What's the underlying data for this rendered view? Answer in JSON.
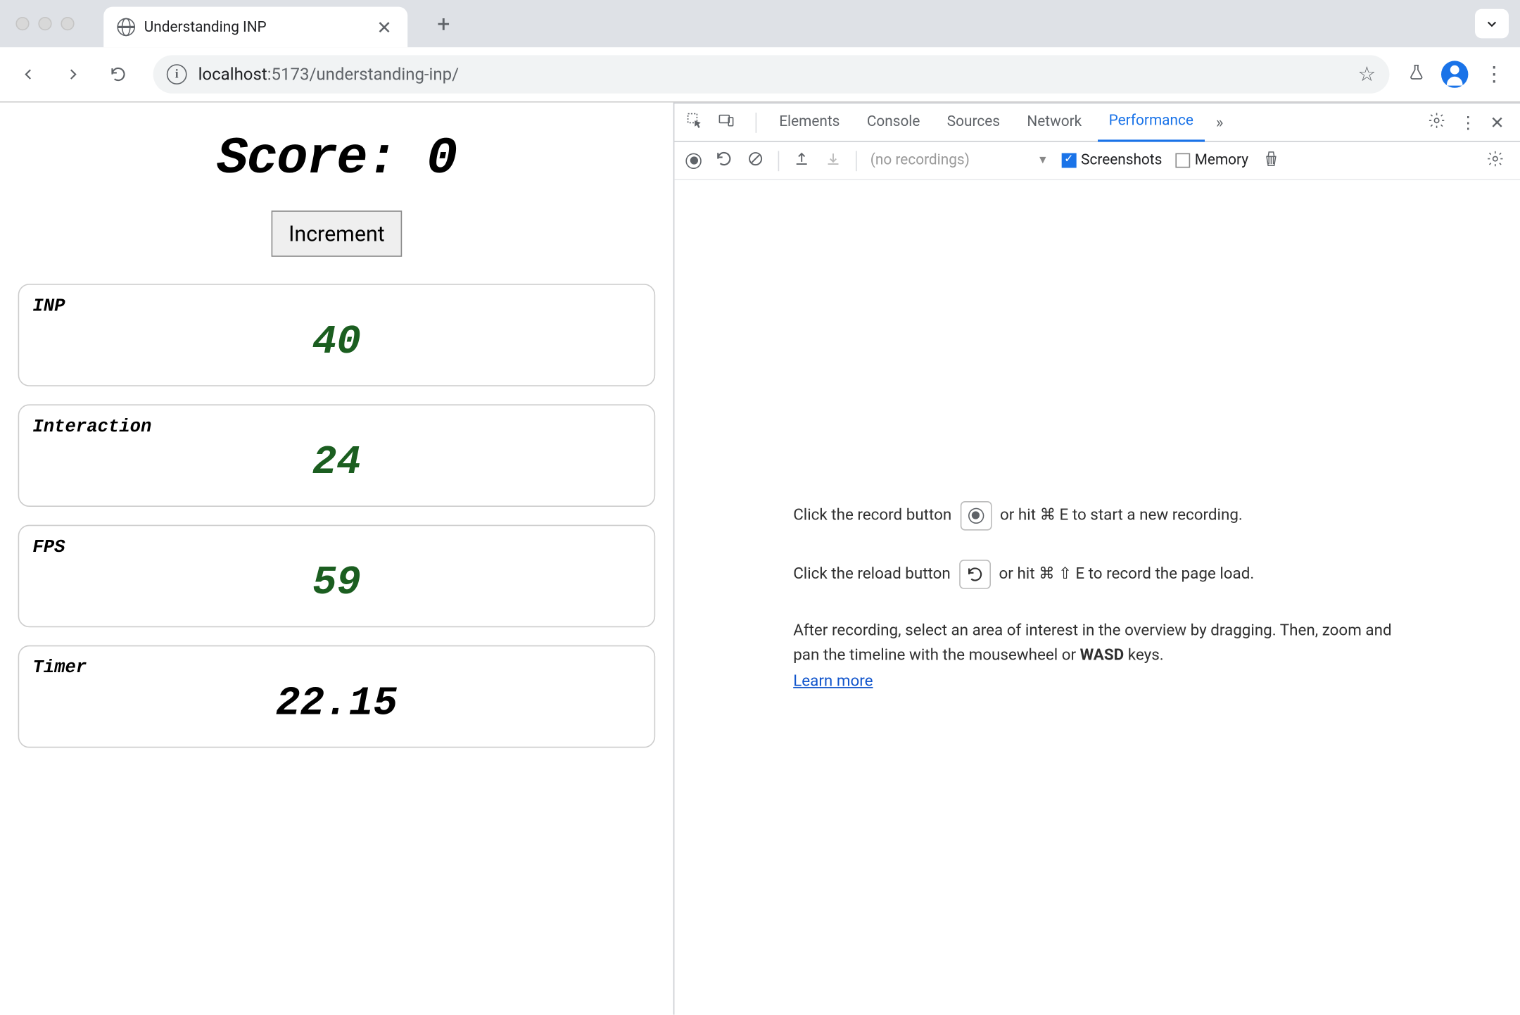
{
  "browser": {
    "tab_title": "Understanding INP",
    "url_host": "localhost",
    "url_port_path": ":5173/understanding-inp/"
  },
  "page": {
    "score_label": "Score:",
    "score_value": "0",
    "increment_label": "Increment",
    "metrics": [
      {
        "label": "INP",
        "value": "40",
        "color": "green"
      },
      {
        "label": "Interaction",
        "value": "24",
        "color": "green"
      },
      {
        "label": "FPS",
        "value": "59",
        "color": "green"
      },
      {
        "label": "Timer",
        "value": "22.15",
        "color": "black"
      }
    ]
  },
  "devtools": {
    "tabs": [
      "Elements",
      "Console",
      "Sources",
      "Network",
      "Performance"
    ],
    "active_tab": "Performance",
    "recordings_placeholder": "(no recordings)",
    "screenshots_label": "Screenshots",
    "memory_label": "Memory",
    "instr_record_1": "Click the record button",
    "instr_record_2": "or hit ⌘ E to start a new recording.",
    "instr_reload_1": "Click the reload button",
    "instr_reload_2": "or hit ⌘ ⇧ E to record the page load.",
    "instr_after_1": "After recording, select an area of interest in the overview by dragging. Then, zoom and pan the timeline with the mousewheel or ",
    "instr_after_bold": "WASD",
    "instr_after_2": " keys.",
    "learn_more": "Learn more"
  }
}
